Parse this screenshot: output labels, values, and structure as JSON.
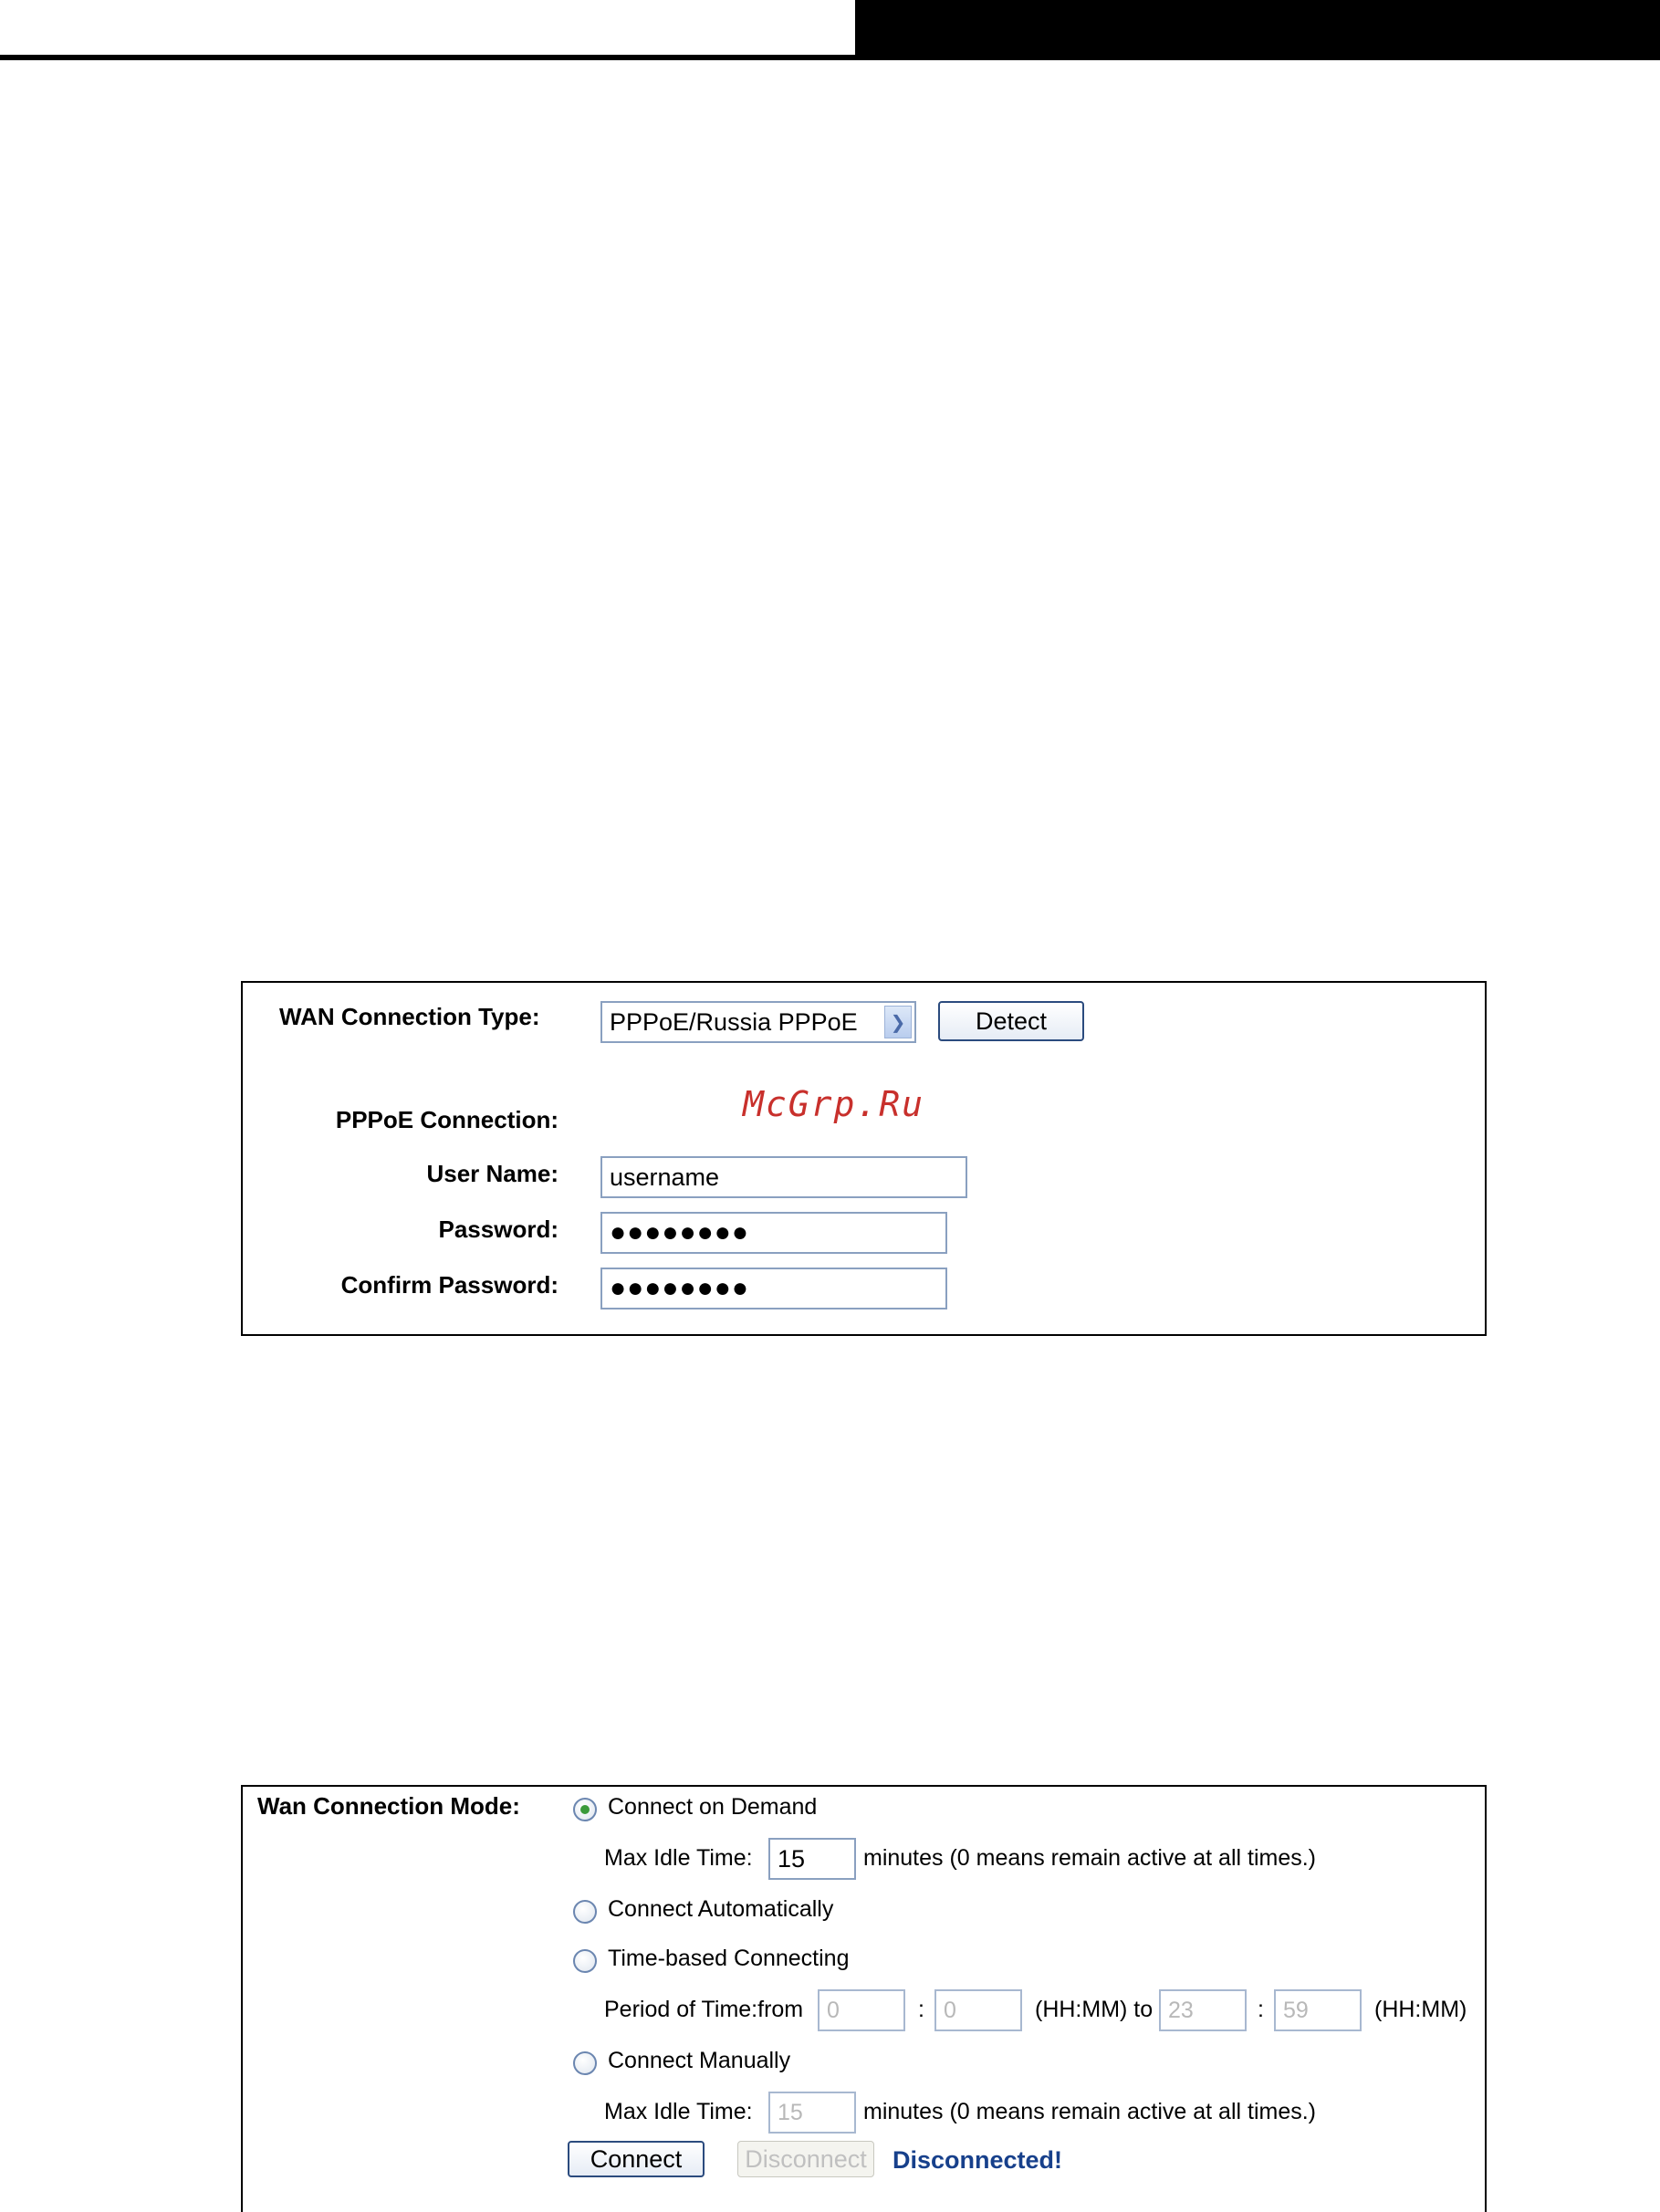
{
  "pppoe_panel": {
    "wan_connection_type_label": "WAN Connection Type:",
    "wan_connection_type_value": "PPPoE/Russia PPPoE",
    "detect_label": "Detect",
    "pppoe_connection_label": "PPPoE Connection:",
    "user_name_label": "User Name:",
    "user_name_value": "username",
    "password_label": "Password:",
    "password_value": "●●●●●●●●",
    "confirm_password_label": "Confirm Password:",
    "confirm_password_value": "●●●●●●●●"
  },
  "watermark": "McGrp.Ru",
  "mode_panel": {
    "mode_label": "Wan Connection Mode:",
    "selected_mode": "Connect on Demand",
    "connect_on_demand_label": "Connect on Demand",
    "max_idle_label": "Max Idle Time:",
    "max_idle_value": "15",
    "minutes_note": "minutes (0 means remain active at all times.)",
    "connect_automatically_label": "Connect Automatically",
    "time_based_label": "Time-based Connecting",
    "period_label": "Period of Time:from",
    "from_hh": "0",
    "colon": ":",
    "from_mm": "0",
    "hhmm_to": "(HH:MM) to",
    "to_hh": "23",
    "to_mm": "59",
    "hhmm": "(HH:MM)",
    "connect_manually_label": "Connect Manually",
    "manual_max_idle_label": "Max Idle Time:",
    "manual_max_idle_value": "15",
    "manual_minutes_note": "minutes (0 means remain active at all times.)",
    "connect_button": "Connect",
    "disconnect_button": "Disconnect",
    "status": "Disconnected!"
  },
  "colors": {
    "status_text": "#17408b",
    "watermark": "#c8302c",
    "radio_selected": "#3a9a3a"
  }
}
